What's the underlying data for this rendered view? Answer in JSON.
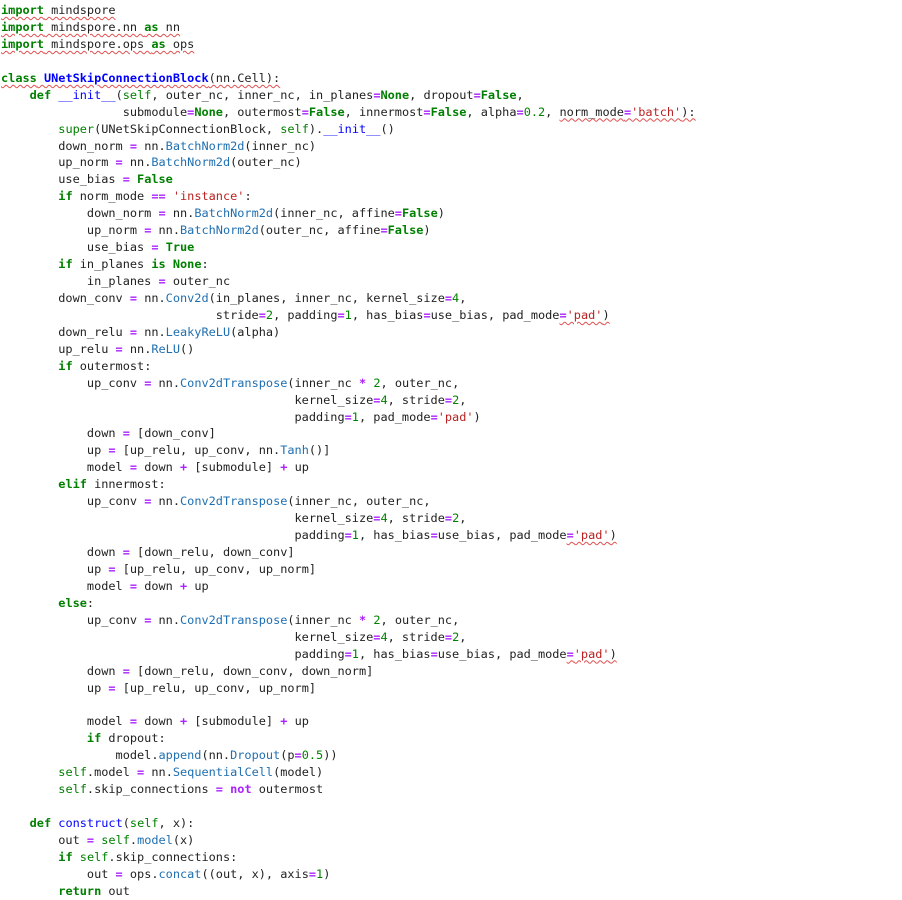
{
  "code": {
    "language": "python",
    "lines": [
      [
        {
          "t": "import",
          "c": "kw sq"
        },
        {
          "t": " mindspore",
          "c": "sq"
        }
      ],
      [
        {
          "t": "import",
          "c": "kw sq"
        },
        {
          "t": " mindspore.nn ",
          "c": "sq"
        },
        {
          "t": "as",
          "c": "kw sq"
        },
        {
          "t": " nn",
          "c": "sq"
        }
      ],
      [
        {
          "t": "import",
          "c": "kw sq"
        },
        {
          "t": " mindspore.ops ",
          "c": "sq"
        },
        {
          "t": "as",
          "c": "kw sq"
        },
        {
          "t": " ops",
          "c": "sq"
        }
      ],
      [],
      [
        {
          "t": "class",
          "c": "kw sq"
        },
        {
          "t": " ",
          "c": "sq"
        },
        {
          "t": "UNetSkipConnectionBlock",
          "c": "cls sq"
        },
        {
          "t": "(nn.Cell):",
          "c": "sq"
        }
      ],
      [
        {
          "t": "    "
        },
        {
          "t": "def",
          "c": "kw"
        },
        {
          "t": " "
        },
        {
          "t": "__init__",
          "c": "fn"
        },
        {
          "t": "("
        },
        {
          "t": "self",
          "c": "bi"
        },
        {
          "t": ", outer_nc, inner_nc, in_planes"
        },
        {
          "t": "=",
          "c": "op"
        },
        {
          "t": "None",
          "c": "kw"
        },
        {
          "t": ", dropout"
        },
        {
          "t": "=",
          "c": "op"
        },
        {
          "t": "False",
          "c": "kw"
        },
        {
          "t": ","
        }
      ],
      [
        {
          "t": "                 submodule"
        },
        {
          "t": "=",
          "c": "op"
        },
        {
          "t": "None",
          "c": "kw"
        },
        {
          "t": ", outermost"
        },
        {
          "t": "=",
          "c": "op"
        },
        {
          "t": "False",
          "c": "kw"
        },
        {
          "t": ", innermost"
        },
        {
          "t": "=",
          "c": "op"
        },
        {
          "t": "False",
          "c": "kw"
        },
        {
          "t": ", alpha"
        },
        {
          "t": "=",
          "c": "op"
        },
        {
          "t": "0.2",
          "c": "num"
        },
        {
          "t": ", "
        },
        {
          "t": "norm_mode",
          "c": "sq"
        },
        {
          "t": "=",
          "c": "op sq"
        },
        {
          "t": "'batch'",
          "c": "str sq"
        },
        {
          "t": "):",
          "c": "sq"
        }
      ],
      [
        {
          "t": "        "
        },
        {
          "t": "super",
          "c": "bi"
        },
        {
          "t": "(UNetSkipConnectionBlock, "
        },
        {
          "t": "self",
          "c": "bi"
        },
        {
          "t": ")."
        },
        {
          "t": "__init__",
          "c": "fn"
        },
        {
          "t": "()"
        }
      ],
      [
        {
          "t": "        down_norm "
        },
        {
          "t": "=",
          "c": "op"
        },
        {
          "t": " nn."
        },
        {
          "t": "BatchNorm2d",
          "c": "attr"
        },
        {
          "t": "(inner_nc)"
        }
      ],
      [
        {
          "t": "        up_norm "
        },
        {
          "t": "=",
          "c": "op"
        },
        {
          "t": " nn."
        },
        {
          "t": "BatchNorm2d",
          "c": "attr"
        },
        {
          "t": "(outer_nc)"
        }
      ],
      [
        {
          "t": "        use_bias "
        },
        {
          "t": "=",
          "c": "op"
        },
        {
          "t": " "
        },
        {
          "t": "False",
          "c": "kw"
        }
      ],
      [
        {
          "t": "        "
        },
        {
          "t": "if",
          "c": "kw"
        },
        {
          "t": " norm_mode "
        },
        {
          "t": "==",
          "c": "op"
        },
        {
          "t": " "
        },
        {
          "t": "'instance'",
          "c": "str"
        },
        {
          "t": ":"
        }
      ],
      [
        {
          "t": "            down_norm "
        },
        {
          "t": "=",
          "c": "op"
        },
        {
          "t": " nn."
        },
        {
          "t": "BatchNorm2d",
          "c": "attr"
        },
        {
          "t": "(inner_nc, affine"
        },
        {
          "t": "=",
          "c": "op"
        },
        {
          "t": "False",
          "c": "kw"
        },
        {
          "t": ")"
        }
      ],
      [
        {
          "t": "            up_norm "
        },
        {
          "t": "=",
          "c": "op"
        },
        {
          "t": " nn."
        },
        {
          "t": "BatchNorm2d",
          "c": "attr"
        },
        {
          "t": "(outer_nc, affine"
        },
        {
          "t": "=",
          "c": "op"
        },
        {
          "t": "False",
          "c": "kw"
        },
        {
          "t": ")"
        }
      ],
      [
        {
          "t": "            use_bias "
        },
        {
          "t": "=",
          "c": "op"
        },
        {
          "t": " "
        },
        {
          "t": "True",
          "c": "kw"
        }
      ],
      [
        {
          "t": "        "
        },
        {
          "t": "if",
          "c": "kw"
        },
        {
          "t": " in_planes "
        },
        {
          "t": "is",
          "c": "kw"
        },
        {
          "t": " "
        },
        {
          "t": "None",
          "c": "kw"
        },
        {
          "t": ":"
        }
      ],
      [
        {
          "t": "            in_planes "
        },
        {
          "t": "=",
          "c": "op"
        },
        {
          "t": " outer_nc"
        }
      ],
      [
        {
          "t": "        down_conv "
        },
        {
          "t": "=",
          "c": "op"
        },
        {
          "t": " nn."
        },
        {
          "t": "Conv2d",
          "c": "attr"
        },
        {
          "t": "(in_planes, inner_nc, kernel_size"
        },
        {
          "t": "=",
          "c": "op"
        },
        {
          "t": "4",
          "c": "num"
        },
        {
          "t": ","
        }
      ],
      [
        {
          "t": "                              stride"
        },
        {
          "t": "=",
          "c": "op"
        },
        {
          "t": "2",
          "c": "num"
        },
        {
          "t": ", padding"
        },
        {
          "t": "=",
          "c": "op"
        },
        {
          "t": "1",
          "c": "num"
        },
        {
          "t": ", has_bias"
        },
        {
          "t": "=",
          "c": "op"
        },
        {
          "t": "use_bias, pad_mode"
        },
        {
          "t": "=",
          "c": "op sq"
        },
        {
          "t": "'pad'",
          "c": "str sq"
        },
        {
          "t": ")",
          "c": "sq"
        }
      ],
      [
        {
          "t": "        down_relu "
        },
        {
          "t": "=",
          "c": "op"
        },
        {
          "t": " nn."
        },
        {
          "t": "LeakyReLU",
          "c": "attr"
        },
        {
          "t": "(alpha)"
        }
      ],
      [
        {
          "t": "        up_relu "
        },
        {
          "t": "=",
          "c": "op"
        },
        {
          "t": " nn."
        },
        {
          "t": "ReLU",
          "c": "attr"
        },
        {
          "t": "()"
        }
      ],
      [
        {
          "t": "        "
        },
        {
          "t": "if",
          "c": "kw"
        },
        {
          "t": " outermost:"
        }
      ],
      [
        {
          "t": "            up_conv "
        },
        {
          "t": "=",
          "c": "op"
        },
        {
          "t": " nn."
        },
        {
          "t": "Conv2dTranspose",
          "c": "attr"
        },
        {
          "t": "(inner_nc "
        },
        {
          "t": "*",
          "c": "op"
        },
        {
          "t": " "
        },
        {
          "t": "2",
          "c": "num"
        },
        {
          "t": ", outer_nc,"
        }
      ],
      [
        {
          "t": "                                         kernel_size"
        },
        {
          "t": "=",
          "c": "op"
        },
        {
          "t": "4",
          "c": "num"
        },
        {
          "t": ", stride"
        },
        {
          "t": "=",
          "c": "op"
        },
        {
          "t": "2",
          "c": "num"
        },
        {
          "t": ","
        }
      ],
      [
        {
          "t": "                                         padding"
        },
        {
          "t": "=",
          "c": "op"
        },
        {
          "t": "1",
          "c": "num"
        },
        {
          "t": ", pad_mode"
        },
        {
          "t": "=",
          "c": "op"
        },
        {
          "t": "'pad'",
          "c": "str"
        },
        {
          "t": ")"
        }
      ],
      [
        {
          "t": "            down "
        },
        {
          "t": "=",
          "c": "op"
        },
        {
          "t": " [down_conv]"
        }
      ],
      [
        {
          "t": "            up "
        },
        {
          "t": "=",
          "c": "op"
        },
        {
          "t": " [up_relu, up_conv, nn."
        },
        {
          "t": "Tanh",
          "c": "attr"
        },
        {
          "t": "()]"
        }
      ],
      [
        {
          "t": "            model "
        },
        {
          "t": "=",
          "c": "op"
        },
        {
          "t": " down "
        },
        {
          "t": "+",
          "c": "op"
        },
        {
          "t": " [submodule] "
        },
        {
          "t": "+",
          "c": "op"
        },
        {
          "t": " up"
        }
      ],
      [
        {
          "t": "        "
        },
        {
          "t": "elif",
          "c": "kw"
        },
        {
          "t": " innermost:"
        }
      ],
      [
        {
          "t": "            up_conv "
        },
        {
          "t": "=",
          "c": "op"
        },
        {
          "t": " nn."
        },
        {
          "t": "Conv2dTranspose",
          "c": "attr"
        },
        {
          "t": "(inner_nc, outer_nc,"
        }
      ],
      [
        {
          "t": "                                         kernel_size"
        },
        {
          "t": "=",
          "c": "op"
        },
        {
          "t": "4",
          "c": "num"
        },
        {
          "t": ", stride"
        },
        {
          "t": "=",
          "c": "op"
        },
        {
          "t": "2",
          "c": "num"
        },
        {
          "t": ","
        }
      ],
      [
        {
          "t": "                                         padding"
        },
        {
          "t": "=",
          "c": "op"
        },
        {
          "t": "1",
          "c": "num"
        },
        {
          "t": ", has_bias"
        },
        {
          "t": "=",
          "c": "op"
        },
        {
          "t": "use_bias, pad_mode"
        },
        {
          "t": "=",
          "c": "op sq"
        },
        {
          "t": "'pad'",
          "c": "str sq"
        },
        {
          "t": ")",
          "c": "sq"
        }
      ],
      [
        {
          "t": "            down "
        },
        {
          "t": "=",
          "c": "op"
        },
        {
          "t": " [down_relu, down_conv]"
        }
      ],
      [
        {
          "t": "            up "
        },
        {
          "t": "=",
          "c": "op"
        },
        {
          "t": " [up_relu, up_conv, up_norm]"
        }
      ],
      [
        {
          "t": "            model "
        },
        {
          "t": "=",
          "c": "op"
        },
        {
          "t": " down "
        },
        {
          "t": "+",
          "c": "op"
        },
        {
          "t": " up"
        }
      ],
      [
        {
          "t": "        "
        },
        {
          "t": "else",
          "c": "kw"
        },
        {
          "t": ":"
        }
      ],
      [
        {
          "t": "            up_conv "
        },
        {
          "t": "=",
          "c": "op"
        },
        {
          "t": " nn."
        },
        {
          "t": "Conv2dTranspose",
          "c": "attr"
        },
        {
          "t": "(inner_nc "
        },
        {
          "t": "*",
          "c": "op"
        },
        {
          "t": " "
        },
        {
          "t": "2",
          "c": "num"
        },
        {
          "t": ", outer_nc,"
        }
      ],
      [
        {
          "t": "                                         kernel_size"
        },
        {
          "t": "=",
          "c": "op"
        },
        {
          "t": "4",
          "c": "num"
        },
        {
          "t": ", stride"
        },
        {
          "t": "=",
          "c": "op"
        },
        {
          "t": "2",
          "c": "num"
        },
        {
          "t": ","
        }
      ],
      [
        {
          "t": "                                         padding"
        },
        {
          "t": "=",
          "c": "op"
        },
        {
          "t": "1",
          "c": "num"
        },
        {
          "t": ", has_bias"
        },
        {
          "t": "=",
          "c": "op"
        },
        {
          "t": "use_bias, pad_mode"
        },
        {
          "t": "=",
          "c": "op sq"
        },
        {
          "t": "'pad'",
          "c": "str sq"
        },
        {
          "t": ")",
          "c": "sq"
        }
      ],
      [
        {
          "t": "            down "
        },
        {
          "t": "=",
          "c": "op"
        },
        {
          "t": " [down_relu, down_conv, down_norm]"
        }
      ],
      [
        {
          "t": "            up "
        },
        {
          "t": "=",
          "c": "op"
        },
        {
          "t": " [up_relu, up_conv, up_norm]"
        }
      ],
      [],
      [
        {
          "t": "            model "
        },
        {
          "t": "=",
          "c": "op"
        },
        {
          "t": " down "
        },
        {
          "t": "+",
          "c": "op"
        },
        {
          "t": " [submodule] "
        },
        {
          "t": "+",
          "c": "op"
        },
        {
          "t": " up"
        }
      ],
      [
        {
          "t": "            "
        },
        {
          "t": "if",
          "c": "kw"
        },
        {
          "t": " dropout:"
        }
      ],
      [
        {
          "t": "                model."
        },
        {
          "t": "append",
          "c": "attr"
        },
        {
          "t": "(nn."
        },
        {
          "t": "Dropout",
          "c": "attr"
        },
        {
          "t": "(p"
        },
        {
          "t": "=",
          "c": "op"
        },
        {
          "t": "0.5",
          "c": "num"
        },
        {
          "t": "))"
        }
      ],
      [
        {
          "t": "        "
        },
        {
          "t": "self",
          "c": "bi"
        },
        {
          "t": ".model "
        },
        {
          "t": "=",
          "c": "op"
        },
        {
          "t": " nn."
        },
        {
          "t": "SequentialCell",
          "c": "attr"
        },
        {
          "t": "(model)"
        }
      ],
      [
        {
          "t": "        "
        },
        {
          "t": "self",
          "c": "bi"
        },
        {
          "t": ".skip_connections "
        },
        {
          "t": "=",
          "c": "op"
        },
        {
          "t": " "
        },
        {
          "t": "not",
          "c": "op"
        },
        {
          "t": " outermost"
        }
      ],
      [],
      [
        {
          "t": "    "
        },
        {
          "t": "def",
          "c": "kw"
        },
        {
          "t": " "
        },
        {
          "t": "construct",
          "c": "fn"
        },
        {
          "t": "("
        },
        {
          "t": "self",
          "c": "bi"
        },
        {
          "t": ", x):"
        }
      ],
      [
        {
          "t": "        out "
        },
        {
          "t": "=",
          "c": "op"
        },
        {
          "t": " "
        },
        {
          "t": "self",
          "c": "bi"
        },
        {
          "t": "."
        },
        {
          "t": "model",
          "c": "attr"
        },
        {
          "t": "(x)"
        }
      ],
      [
        {
          "t": "        "
        },
        {
          "t": "if",
          "c": "kw"
        },
        {
          "t": " "
        },
        {
          "t": "self",
          "c": "bi"
        },
        {
          "t": ".skip_connections:"
        }
      ],
      [
        {
          "t": "            out "
        },
        {
          "t": "=",
          "c": "op"
        },
        {
          "t": " ops."
        },
        {
          "t": "concat",
          "c": "attr"
        },
        {
          "t": "((out, x), axis"
        },
        {
          "t": "=",
          "c": "op"
        },
        {
          "t": "1",
          "c": "num"
        },
        {
          "t": ")"
        }
      ],
      [
        {
          "t": "        "
        },
        {
          "t": "return",
          "c": "kw"
        },
        {
          "t": " out"
        }
      ]
    ]
  }
}
